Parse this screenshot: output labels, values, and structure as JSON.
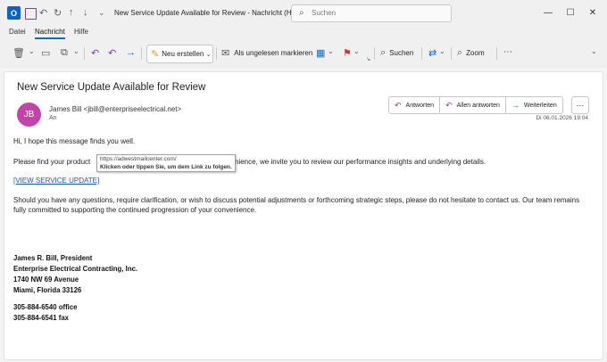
{
  "titlebar": {
    "title": "New Service Update Available for Review  -  Nachricht (HT...",
    "search_placeholder": "Suchen"
  },
  "menu": {
    "items": [
      "Datei",
      "Nachricht",
      "Hilfe"
    ]
  },
  "ribbon": {
    "new_label": "Neu erstellen",
    "mark_unread_label": "Als ungelesen markieren",
    "search_label": "Suchen",
    "zoom_label": "Zoom"
  },
  "message": {
    "subject": "New Service Update Available for Review",
    "avatar_initials": "JB",
    "sender": "James Bill <jbill@enterpriseelectrical.net>",
    "to_label": "An",
    "reply_label": "Antworten",
    "reply_all_label": "Allen antworten",
    "forward_label": "Weiterleiten",
    "date": "Di 06.01.2026 19:04",
    "greeting": "Hi, I hope this message finds you well.",
    "para1_start": "Please find your product",
    "para1_end": "nience, we invite you to review our performance insights and underlying details.",
    "link_text": "[VIEW SERVICE UPDATE]",
    "tooltip_url": "https://adwestmailcenter.com/",
    "tooltip_hint": "Klicken oder tippen Sie, um dem Link zu folgen.",
    "para2": "Should you have any questions, require clarification, or wish to discuss potential adjustments or forthcoming strategic steps, please do not hesitate to contact us. Our team remains fully committed to supporting the continued progression of your convenience.",
    "signature": [
      "James R. Bill, President",
      "Enterprise Electrical Contracting, Inc.",
      "1740 NW 69 Avenue",
      "Miami, Florida 33126"
    ],
    "phones": [
      "305-884-6540 office",
      "305-884-6541 fax"
    ]
  },
  "colors": {
    "accent": "#0f6cbd",
    "avatar": "#c443a8",
    "link": "#1a55d4"
  }
}
